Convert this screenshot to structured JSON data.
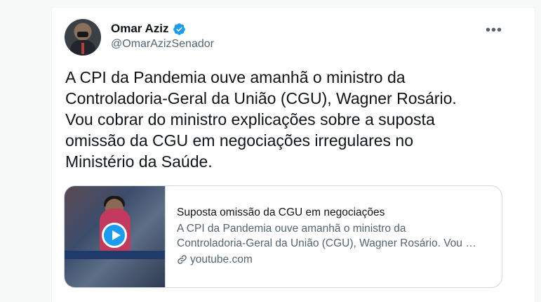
{
  "tweet": {
    "author": {
      "display_name": "Omar Aziz",
      "handle": "@OmarAzizSenador",
      "verified": true
    },
    "more_label": "•••",
    "text": "A CPI da Pandemia ouve amanhã o ministro da\nControladoria-Geral da União (CGU), Wagner Rosário.\nVou cobrar do ministro explicações sobre a suposta\nomissão da CGU em negociações irregulares no\nMinistério da Saúde.",
    "link_card": {
      "title": "Suposta omissão da CGU em negociações",
      "description_line1": "A CPI da Pandemia ouve amanhã o ministro da",
      "description_line2": "Controladoria-Geral da União (CGU), Wagner Rosário. Vou …",
      "domain": "youtube.com",
      "thumbnail_icon": "play-icon"
    }
  },
  "colors": {
    "accent": "#1d9bf0",
    "text_primary": "#0f1419",
    "text_secondary": "#536471",
    "border": "#cfd9de"
  }
}
